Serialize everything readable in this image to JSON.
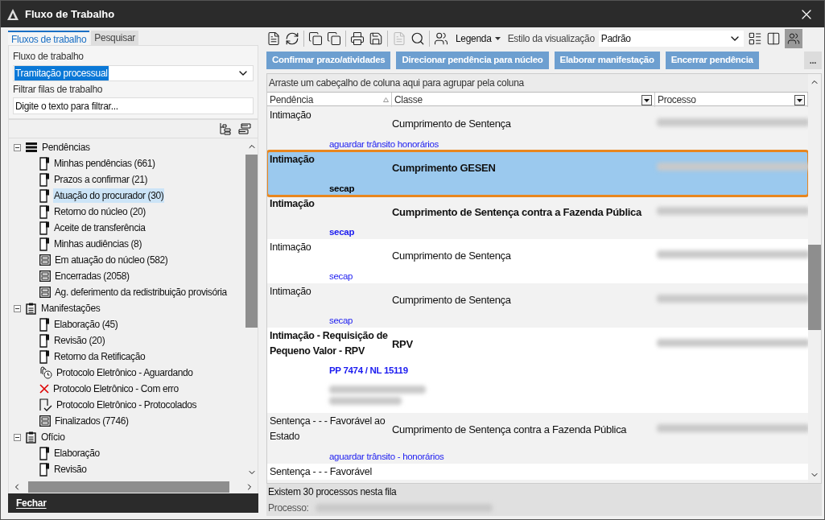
{
  "window": {
    "title": "Fluxo de Trabalho"
  },
  "left_tabs": [
    {
      "label": "Fluxos de trabalho",
      "selected": true
    },
    {
      "label": "Pesquisar",
      "selected": false
    }
  ],
  "workflow": {
    "label": "Fluxo de trabalho",
    "value": "Tramitação processual"
  },
  "filter": {
    "label": "Filtrar filas de trabalho",
    "placeholder": "Digite o texto para filtrar..."
  },
  "tree": [
    {
      "label": "Pendências",
      "kind": "stack",
      "expanded": true,
      "children": [
        {
          "label": "Minhas pendências (661)",
          "kind": "queue",
          "selected": false
        },
        {
          "label": "Prazos a confirmar (21)",
          "kind": "queue",
          "selected": false
        },
        {
          "label": "Atuação do procurador (30)",
          "kind": "queue",
          "selected": true
        },
        {
          "label": "Retorno do núcleo (20)",
          "kind": "queue",
          "selected": false
        },
        {
          "label": "Aceite de transferência",
          "kind": "queue",
          "selected": false
        },
        {
          "label": "Minhas audiências (8)",
          "kind": "queue",
          "selected": false
        },
        {
          "label": "Em atuação do núcleo (582)",
          "kind": "archive",
          "selected": false
        },
        {
          "label": "Encerradas (2058)",
          "kind": "archive",
          "selected": false
        },
        {
          "label": "Ag. deferimento da redistribuição provisória",
          "kind": "archive",
          "selected": false
        }
      ]
    },
    {
      "label": "Manifestações",
      "kind": "clipboard",
      "expanded": true,
      "children": [
        {
          "label": "Elaboração (45)",
          "kind": "queue",
          "selected": false
        },
        {
          "label": "Revisão (20)",
          "kind": "queue",
          "selected": false
        },
        {
          "label": "Retorno da Retificação",
          "kind": "queue",
          "selected": false
        },
        {
          "label": "Protocolo Eletrônico - Aguardando",
          "kind": "clock",
          "selected": false
        },
        {
          "label": "Protocolo Eletrônico - Com erro",
          "kind": "error",
          "selected": false
        },
        {
          "label": "Protocolo Eletrônico - Protocolados",
          "kind": "done",
          "selected": false
        },
        {
          "label": "Finalizados (7746)",
          "kind": "archive",
          "selected": false
        }
      ]
    },
    {
      "label": "Ofício",
      "kind": "clipboard",
      "expanded": true,
      "children": [
        {
          "label": "Elaboração",
          "kind": "queue",
          "selected": false
        },
        {
          "label": "Revisão",
          "kind": "queue",
          "selected": false
        }
      ]
    }
  ],
  "close_button": "Fechar",
  "toolbar": {
    "legend": "Legenda",
    "view_style_label": "Estilo da visualização",
    "view_style": "Padrão"
  },
  "actions": [
    "Confirmar prazo/atividades",
    "Direcionar pendência para núcleo",
    "Elaborar manifestação",
    "Encerrar pendência"
  ],
  "more_button": "...",
  "group_hint": "Arraste um cabeçalho de coluna aqui para agrupar pela coluna",
  "columns": [
    {
      "label": "Pendência",
      "sorted": true
    },
    {
      "label": "Classe",
      "sorted": false
    },
    {
      "label": "Processo",
      "sorted": false
    }
  ],
  "rows": [
    {
      "pendencia": "Intimação",
      "classe": "Cumprimento de Sentença",
      "note": "aguardar trânsito honorários",
      "unread": false,
      "selected": false
    },
    {
      "pendencia": "Intimação",
      "classe": "Cumprimento GESEN",
      "note": "secap",
      "unread": true,
      "selected": true
    },
    {
      "pendencia": "Intimação",
      "classe": "Cumprimento de Sentença contra a Fazenda Pública",
      "note": "secap",
      "unread": true,
      "selected": false
    },
    {
      "pendencia": "Intimação",
      "classe": "Cumprimento de Sentença",
      "note": "secap",
      "unread": false,
      "selected": false
    },
    {
      "pendencia": "Intimação",
      "classe": "Cumprimento de Sentença",
      "note": "secap",
      "unread": false,
      "selected": false
    },
    {
      "pendencia": "Intimação - Requisição de Pequeno Valor - RPV",
      "classe": "RPV",
      "note": "PP 7474 / NL 15119",
      "unread": true,
      "selected": false,
      "extra_redacted": true
    },
    {
      "pendencia": "Sentença - - - Favorável ao Estado",
      "classe": "Cumprimento de Sentença contra a Fazenda Pública",
      "note": "aguardar trânsito - honorários",
      "unread": false,
      "selected": false
    },
    {
      "pendencia": "Sentença - - - Favorável",
      "unread": false,
      "selected": false,
      "cut": true
    }
  ],
  "status": "Existem 30 processos nesta fila",
  "process_label": "Processo:"
}
